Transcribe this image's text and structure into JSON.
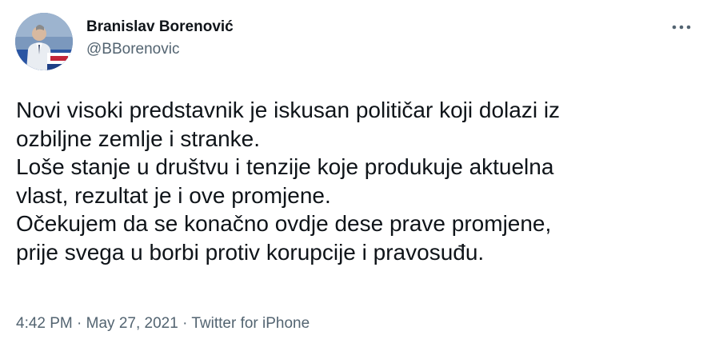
{
  "author": {
    "display_name": "Branislav Borenović",
    "handle": "@BBorenovic"
  },
  "tweet": {
    "lines": [
      "Novi visoki predstavnik je iskusan političar koji dolazi iz",
      "ozbiljne zemlje i stranke.",
      "Loše stanje u društvu i tenzije koje produkuje aktuelna",
      "vlast, rezultat je i ove promjene.",
      "Očekujem da se konačno ovdje dese prave promjene,",
      "prije svega u borbi protiv korupcije i pravosuđu."
    ]
  },
  "meta": {
    "time": "4:42 PM",
    "separator": " · ",
    "date": "May 27, 2021",
    "source": "Twitter for iPhone"
  },
  "icons": {
    "more": "more-horizontal-icon",
    "avatar": "profile-photo"
  },
  "colors": {
    "text": "#0f1419",
    "secondary": "#536471"
  }
}
